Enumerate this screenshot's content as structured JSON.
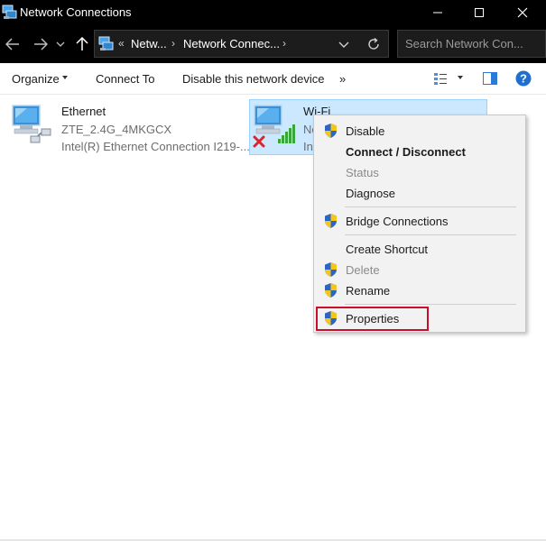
{
  "window": {
    "title": "Network Connections"
  },
  "address": {
    "overflow": "«",
    "crumbs": [
      "Netw...",
      "Network Connec..."
    ],
    "search_placeholder": "Search Network Con..."
  },
  "toolbar": {
    "organize": "Organize",
    "connect_to": "Connect To",
    "disable_device": "Disable this network device",
    "more": "»"
  },
  "items": [
    {
      "name": "Ethernet",
      "status": "ZTE_2.4G_4MKGCX",
      "device": "Intel(R) Ethernet Connection I219-..."
    },
    {
      "name": "Wi-Fi",
      "status_partial": "Ne",
      "device_partial": "Int"
    }
  ],
  "context_menu": {
    "items": [
      {
        "label": "Disable",
        "shield": true,
        "bold": false,
        "disabled": false
      },
      {
        "label": "Connect / Disconnect",
        "shield": false,
        "bold": true,
        "disabled": false
      },
      {
        "label": "Status",
        "shield": false,
        "bold": false,
        "disabled": true
      },
      {
        "label": "Diagnose",
        "shield": false,
        "bold": false,
        "disabled": false
      },
      {
        "label": "Bridge Connections",
        "shield": true,
        "bold": false,
        "disabled": false
      },
      {
        "label": "Create Shortcut",
        "shield": false,
        "bold": false,
        "disabled": false
      },
      {
        "label": "Delete",
        "shield": true,
        "bold": false,
        "disabled": true
      },
      {
        "label": "Rename",
        "shield": true,
        "bold": false,
        "disabled": false
      },
      {
        "label": "Properties",
        "shield": true,
        "bold": false,
        "disabled": false
      }
    ],
    "highlighted": "Properties"
  },
  "colors": {
    "titlebar": "#000000",
    "selection": "#cce8ff",
    "highlight_box": "#c8102e",
    "help_blue": "#1f6fd0"
  }
}
